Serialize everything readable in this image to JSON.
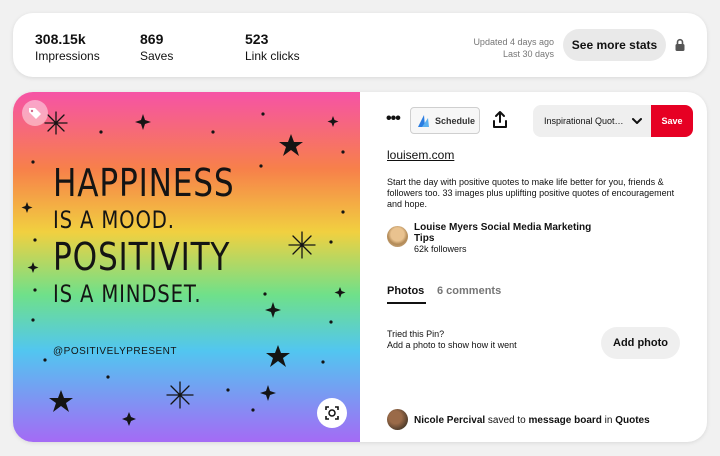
{
  "stats": {
    "impressions": {
      "value": "308.15k",
      "label": "Impressions"
    },
    "saves": {
      "value": "869",
      "label": "Saves"
    },
    "link_clicks": {
      "value": "523",
      "label": "Link clicks"
    },
    "updated": "Updated 4 days ago",
    "period": "Last 30 days",
    "see_more_label": "See more stats"
  },
  "pin": {
    "image": {
      "quote_lines": [
        "HAPPINESS",
        "IS A MOOD.",
        "POSITIVITY",
        "IS A MINDSET."
      ],
      "handle": "@POSITIVELYPRESENT"
    },
    "toolbar": {
      "more_label": "•••",
      "schedule_label": "Schedule",
      "board_name": "Inspirational Quot…",
      "save_label": "Save"
    },
    "source_link": "louisem.com",
    "description": "Start the day with positive quotes to make life better for you, friends & followers too. 33 images plus uplifting positive quotes of encouragement and hope.",
    "creator": {
      "name": "Louise Myers Social Media Marketing Tips",
      "followers": "62k followers"
    },
    "tabs": {
      "photos": "Photos",
      "comments": "6 comments"
    },
    "tried": {
      "title": "Tried this Pin?",
      "subtitle": "Add a photo to show how it went",
      "button_label": "Add photo"
    },
    "activity": {
      "user": "Nicole Percival",
      "verb": " saved to ",
      "board": "message board",
      "preposition": " in ",
      "section": "Quotes"
    }
  },
  "colors": {
    "save_red": "#e60023",
    "link_text": "#111111",
    "muted": "#767676"
  }
}
